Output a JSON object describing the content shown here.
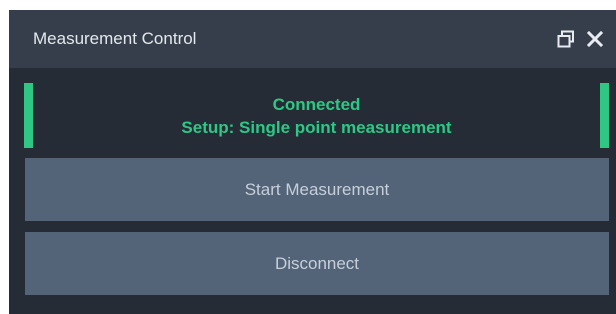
{
  "window": {
    "title": "Measurement Control",
    "icons": {
      "float": "float-window-icon",
      "close": "close-icon"
    }
  },
  "status": {
    "line1": "Connected",
    "line2": "Setup: Single point measurement",
    "accent_color": "#2ec884"
  },
  "buttons": {
    "start_label": "Start Measurement",
    "disconnect_label": "Disconnect"
  },
  "colors": {
    "titlebar": "#353e4a",
    "panel": "#252c36",
    "button": "#536378",
    "status_text": "#2ec884"
  }
}
